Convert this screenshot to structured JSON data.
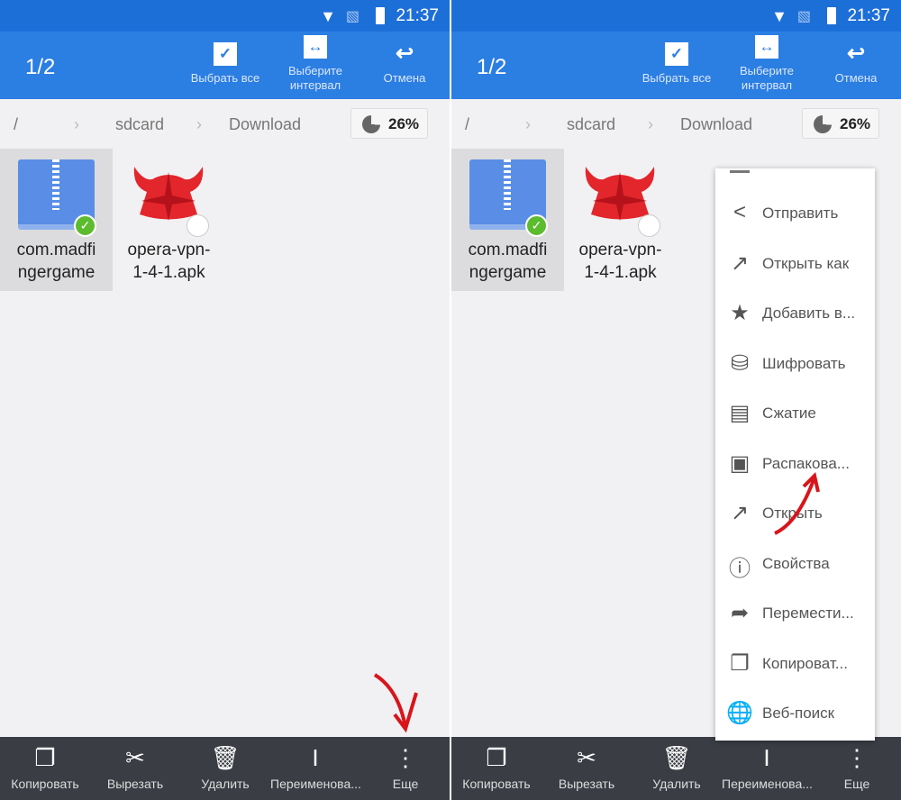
{
  "status": {
    "time": "21:37",
    "icons": [
      "wifi-icon",
      "no-sim-icon",
      "battery-icon"
    ]
  },
  "toolbar": {
    "count": "1/2",
    "select_all": "Выбрать все",
    "select_range": "Выберите интервал",
    "cancel": "Отмена"
  },
  "breadcrumb": [
    "/",
    "sdcard",
    "Download"
  ],
  "storage": {
    "percent": "26%",
    "used": 26
  },
  "files": [
    {
      "name": "com.madfingergame",
      "line1": "com.madfi",
      "line2": "ngergame",
      "selected": true,
      "icon": "zip-archive-icon"
    },
    {
      "name": "opera-vpn-1-4-1.apk",
      "line1": "opera-vpn-",
      "line2": "1-4-1.apk",
      "selected": false,
      "icon": "opera-vpn-icon"
    }
  ],
  "bottom": [
    {
      "label": "Копировать",
      "icon": "copy-icon"
    },
    {
      "label": "Вырезать",
      "icon": "scissors-icon"
    },
    {
      "label": "Удалить",
      "icon": "trash-icon"
    },
    {
      "label": "Переименова...",
      "icon": "rename-icon"
    },
    {
      "label": "Еще",
      "icon": "more-icon"
    }
  ],
  "menu": [
    {
      "label": "Отправить",
      "icon": "share-icon"
    },
    {
      "label": "Открыть как",
      "icon": "open-external-icon"
    },
    {
      "label": "Добавить в...",
      "icon": "star-icon"
    },
    {
      "label": "Шифровать",
      "icon": "encrypt-icon"
    },
    {
      "label": "Сжатие",
      "icon": "compress-icon"
    },
    {
      "label": "Распакова...",
      "icon": "extract-icon"
    },
    {
      "label": "Открыть",
      "icon": "open-external-icon"
    },
    {
      "label": "Свойства",
      "icon": "info-icon"
    },
    {
      "label": "Перемести...",
      "icon": "move-icon"
    },
    {
      "label": "Копироват...",
      "icon": "copy-icon"
    },
    {
      "label": "Веб-поиск",
      "icon": "web-search-icon"
    }
  ],
  "colors": {
    "status_bar": "#1d6fd8",
    "toolbar": "#2b7ee2",
    "bottom_bar": "#3a3d44",
    "check": "#5dbb2e",
    "annotation_arrow": "#d8151b"
  }
}
